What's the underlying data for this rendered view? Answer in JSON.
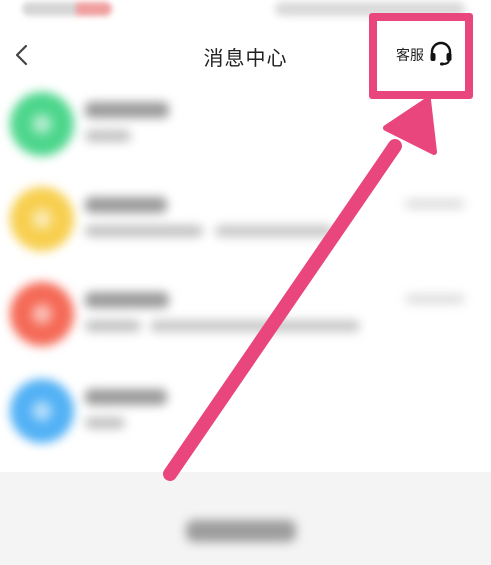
{
  "header": {
    "title": "消息中心",
    "service_label": "客服",
    "back_icon": "chevron-left-icon",
    "service_icon": "headset-icon"
  },
  "list": {
    "items": [
      {
        "avatar_color": "#4dd68c"
      },
      {
        "avatar_color": "#f7cf4f"
      },
      {
        "avatar_color": "#f56a57"
      },
      {
        "avatar_color": "#52b1f5"
      }
    ]
  },
  "colors": {
    "highlight": "#e8467c",
    "arrow": "#e8467c"
  }
}
